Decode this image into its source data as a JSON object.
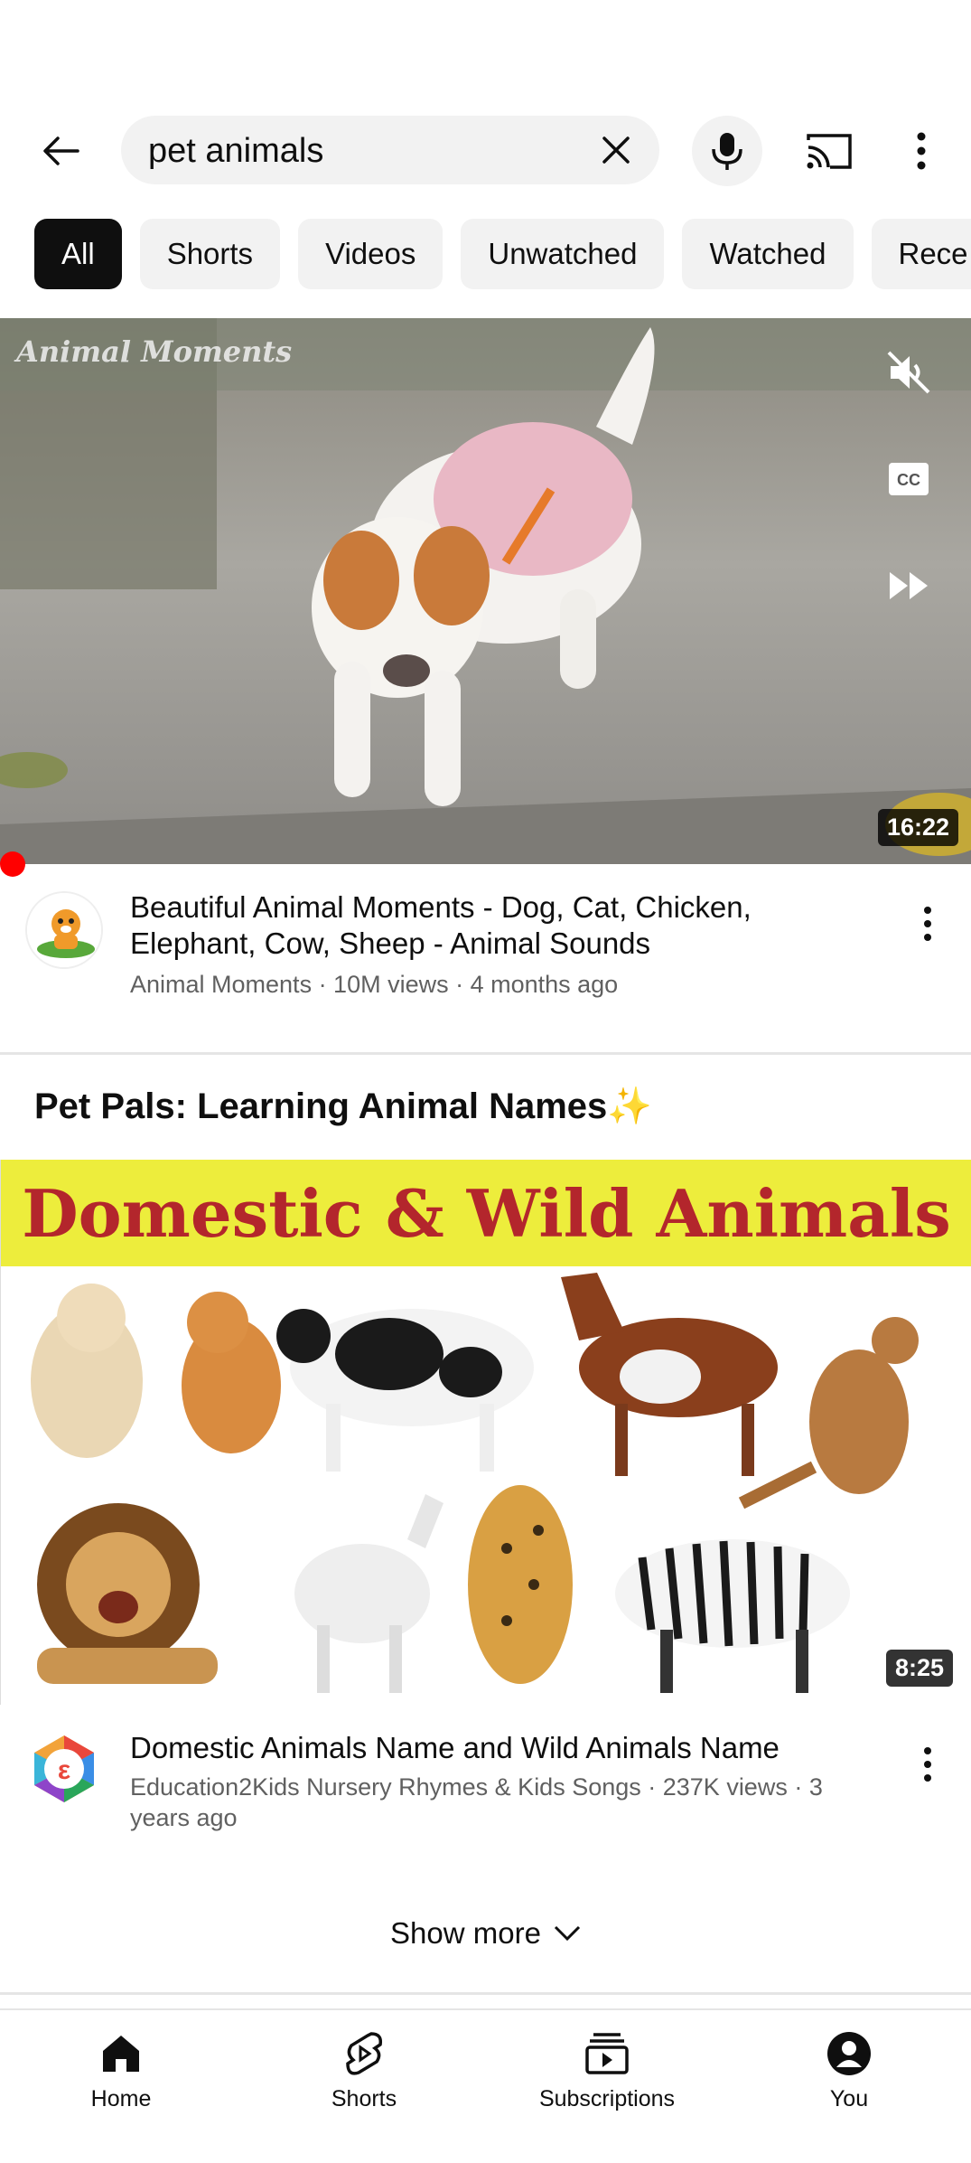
{
  "search": {
    "query": "pet animals",
    "back_icon": "arrow-left-icon",
    "clear_icon": "close-icon",
    "mic_icon": "microphone-icon",
    "cast_icon": "cast-icon",
    "more_icon": "more-vertical-icon"
  },
  "chips": [
    "All",
    "Shorts",
    "Videos",
    "Unwatched",
    "Watched",
    "Rece"
  ],
  "video1": {
    "watermark": "Animal Moments",
    "duration": "16:22",
    "title": "Beautiful Animal Moments - Dog, Cat, Chicken, Elephant, Cow, Sheep - Animal Sounds",
    "subtitle": "Animal Moments · 10M views · 4 months ago"
  },
  "section": {
    "title": "Pet Pals: Learning Animal Names✨"
  },
  "video2": {
    "banner": "Domestic & Wild Animals",
    "duration": "8:25",
    "title": "Domestic Animals Name and Wild Animals Name",
    "subtitle": "Education2Kids Nursery Rhymes & Kids Songs · 237K views · 3 years ago"
  },
  "show_more": "Show more",
  "nav": {
    "home": "Home",
    "shorts": "Shorts",
    "subscriptions": "Subscriptions",
    "you": "You"
  },
  "colors": {
    "accent": "#ff0000",
    "chip_bg": "#f2f2f2",
    "chip_active": "#0f0f0f",
    "banner_bg": "#eded3c",
    "banner_text": "#b3262c"
  }
}
